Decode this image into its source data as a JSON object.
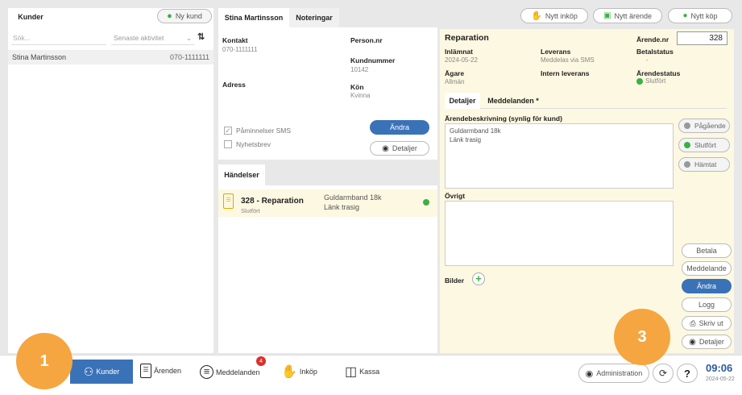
{
  "customers_panel": {
    "tab_label": "Kunder",
    "new_customer_button": "Ny kund",
    "search_placeholder": "Sök...",
    "sort_select": "Senaste aktivitet",
    "rows": [
      {
        "name": "Stina Martinsson",
        "phone": "070-1111111"
      }
    ]
  },
  "customer_detail": {
    "tabs": [
      "Stina Martinsson",
      "Noteringar"
    ],
    "contact_label": "Kontakt",
    "contact_value": "070-1111111",
    "personnr_label": "Person.nr",
    "kundnummer_label": "Kundnummer",
    "kundnummer_value": "10142",
    "adress_label": "Adress",
    "kon_label": "Kön",
    "kon_value": "Kvinna",
    "sms_reminder_label": "Påminnelser SMS",
    "newsletter_label": "Nyhetsbrev",
    "andra_button": "Ändra",
    "detaljer_button": "Detaljer"
  },
  "events": {
    "tab_label": "Händelser",
    "items": [
      {
        "title": "328 - Reparation",
        "status": "Slutfört",
        "desc1": "Guldarmband 18k",
        "desc2": "Länk trasig",
        "status_color": "#3cb043"
      }
    ]
  },
  "top_actions": {
    "nytt_inkop": "Nytt inköp",
    "nytt_arende": "Nytt ärende",
    "nytt_kop": "Nytt köp"
  },
  "repair": {
    "title": "Reparation",
    "arende_nr_label": "Ärende.nr",
    "arende_nr_value": "328",
    "inlamnat_label": "Inlämnat",
    "inlamnat_value": "2024-05-22",
    "leverans_label": "Leverans",
    "leverans_value": "Meddelas via SMS",
    "betalstatus_label": "Betalstatus",
    "betalstatus_value": "-",
    "agare_label": "Ägare",
    "agare_value": "Allmän",
    "intern_leverans_label": "Intern leverans",
    "arendestatus_label": "Ärendestatus",
    "arendestatus_value": "Slutfört",
    "subtabs": [
      "Detaljer",
      "Meddelanden *"
    ],
    "description_label": "Ärendebeskrivning (synlig för kund)",
    "description_text": "Guldarmband 18k\nLänk trasig",
    "ovrigt_label": "Övrigt",
    "bilder_label": "Bilder",
    "status_buttons": [
      {
        "label": "Pågående",
        "color": "#999999"
      },
      {
        "label": "Slutfört",
        "color": "#3cb043"
      },
      {
        "label": "Hämtat",
        "color": "#999999"
      }
    ],
    "action_buttons": {
      "betala": "Betala",
      "meddelande": "Meddelande",
      "andra": "Ändra",
      "logg": "Logg",
      "skriv_ut": "Skriv ut",
      "detaljer": "Detaljer"
    }
  },
  "bottom_nav": {
    "kunder": "Kunder",
    "arenden": "Ärenden",
    "meddelanden": "Meddelanden",
    "meddelanden_badge": "4",
    "inkop": "Inköp",
    "kassa": "Kassa",
    "administration": "Administration",
    "time": "09:06",
    "date": "2024-05-22"
  },
  "callouts": [
    "1",
    "3"
  ],
  "colors": {
    "accent": "#3a72b8",
    "yellow_bg": "#fdf8e1",
    "callout": "#f5a640",
    "green": "#3cb043"
  }
}
